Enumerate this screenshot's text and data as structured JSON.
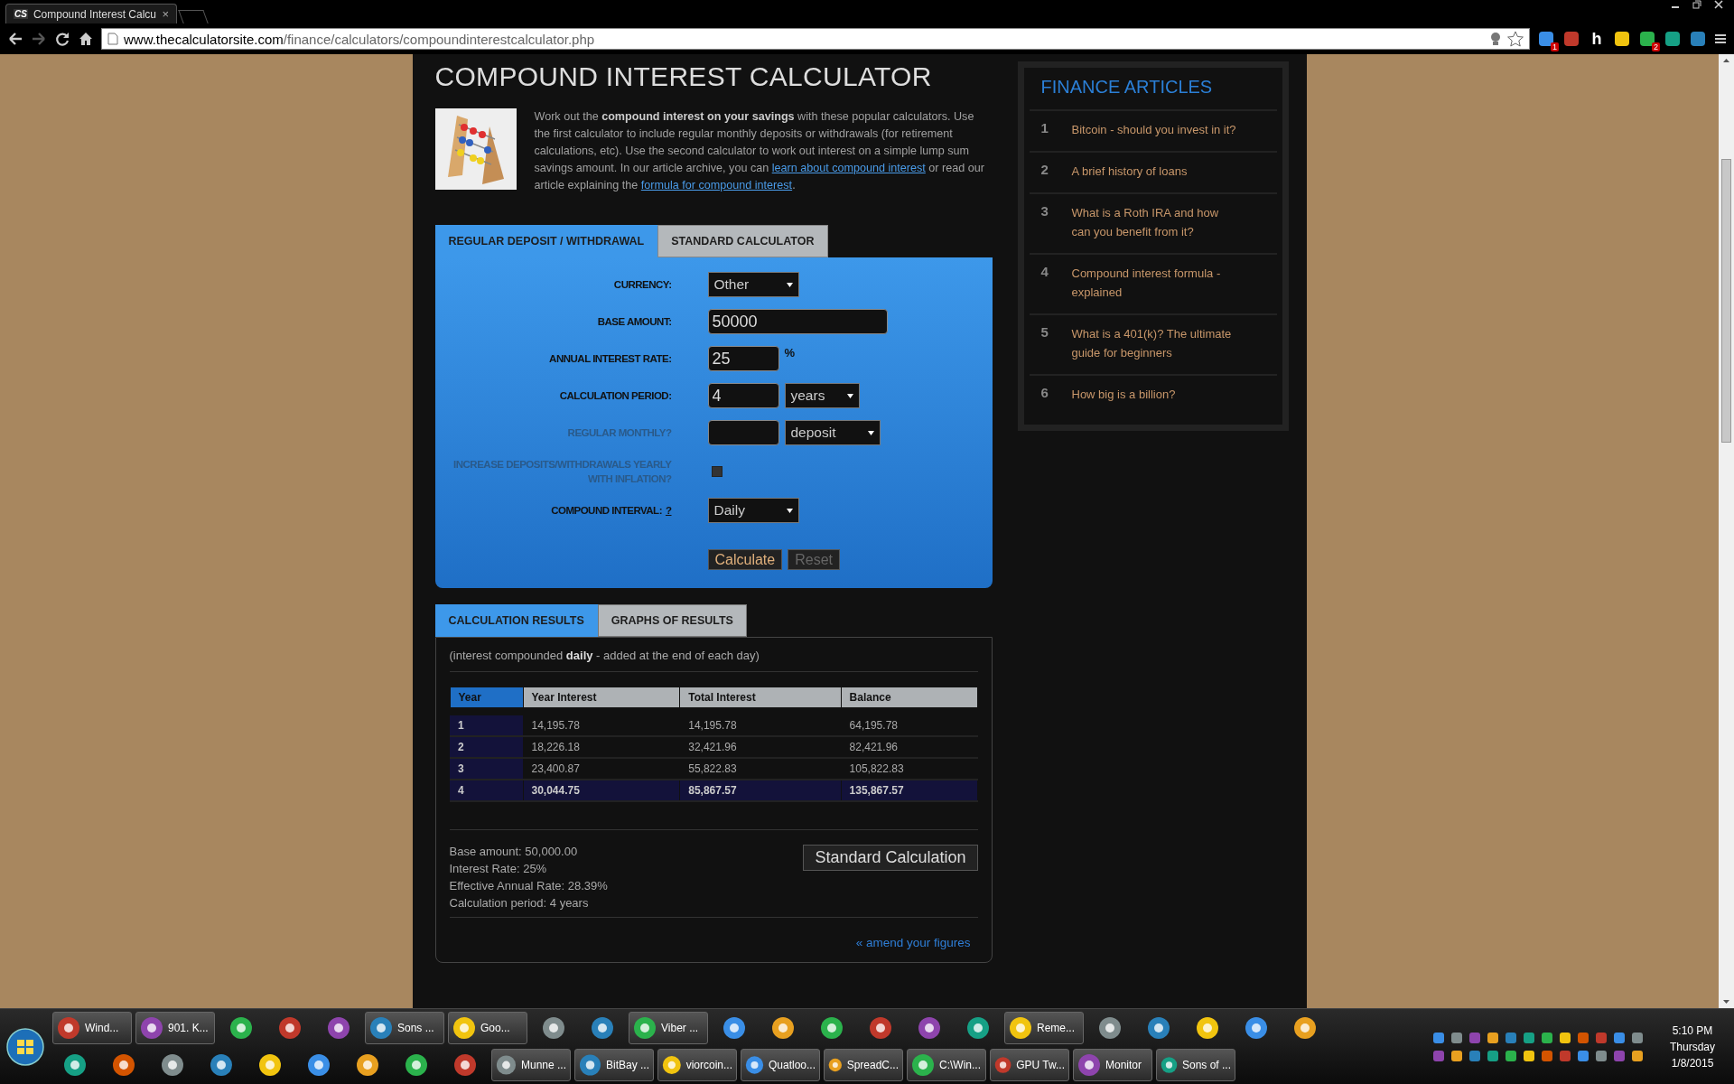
{
  "browser": {
    "tab": {
      "favicon": "CS",
      "title": "Compound Interest Calcu",
      "close": "×"
    },
    "url_host": "www.thecalculatorsite.com",
    "url_path": "/finance/calculators/compoundinterestcalculator.php",
    "extensions": [
      {
        "kind": "icon",
        "badge": "1"
      },
      {
        "kind": "icon"
      },
      {
        "kind": "letter",
        "glyph": "h"
      },
      {
        "kind": "icon"
      },
      {
        "kind": "icon",
        "badge": "2"
      },
      {
        "kind": "icon"
      },
      {
        "kind": "icon"
      }
    ]
  },
  "page": {
    "title": "COMPOUND INTEREST CALCULATOR",
    "intro": [
      {
        "kind": "text",
        "text": "Work out the **compound interest on your savings** with these popular calculators. Use the first calculator to include regular monthly deposits or withdrawals (for retirement calculations, etc). Use the second calculator to work out interest on a simple lump sum savings amount. In our article archive, you can "
      },
      {
        "kind": "link",
        "text": "learn about compound interest"
      },
      {
        "kind": "text",
        "text": " or read our article explaining the "
      },
      {
        "kind": "link",
        "text": "formula for compound interest"
      },
      {
        "kind": "text",
        "text": "."
      }
    ],
    "calc_tabs": [
      {
        "label": "REGULAR DEPOSIT / WITHDRAWAL",
        "selected": true
      },
      {
        "label": "STANDARD CALCULATOR",
        "selected": false
      }
    ],
    "fields": [
      {
        "label": "CURRENCY:",
        "disabled": false,
        "controls": [
          {
            "kind": "select",
            "value": "Other"
          }
        ]
      },
      {
        "label": "BASE AMOUNT:",
        "disabled": false,
        "controls": [
          {
            "kind": "wide-input",
            "value": "50000"
          }
        ]
      },
      {
        "label": "ANNUAL INTEREST RATE:",
        "disabled": false,
        "controls": [
          {
            "kind": "input",
            "value": "25"
          },
          {
            "kind": "unit",
            "text": "%"
          }
        ]
      },
      {
        "label": "CALCULATION PERIOD:",
        "disabled": false,
        "controls": [
          {
            "kind": "input",
            "value": "4"
          },
          {
            "kind": "small-select",
            "value": "years"
          }
        ]
      },
      {
        "label": "REGULAR MONTHLY?",
        "disabled": true,
        "controls": [
          {
            "kind": "input"
          },
          {
            "kind": "select",
            "value": "deposit"
          }
        ]
      },
      {
        "label": "INCREASE DEPOSITS/WITHDRAWALS YEARLY WITH INFLATION?",
        "disabled": true,
        "controls": [
          {
            "kind": "checkbox",
            "checked": false
          }
        ]
      },
      {
        "label": "COMPOUND INTERVAL:",
        "help": "?",
        "disabled": false,
        "controls": [
          {
            "kind": "select",
            "value": "Daily"
          }
        ]
      }
    ],
    "buttons": [
      {
        "label": "Calculate",
        "disabled": false
      },
      {
        "label": "Reset",
        "disabled": true
      }
    ],
    "result_tabs": [
      {
        "label": "CALCULATION RESULTS",
        "selected": true
      },
      {
        "label": "GRAPHS OF RESULTS",
        "selected": false
      }
    ],
    "note": "(interest compounded **daily** - added at the end of each day)",
    "table": {
      "columns": [
        "Year",
        "Year Interest",
        "Total Interest",
        "Balance"
      ],
      "rows": [
        {
          "cells": [
            "1",
            "14,195.78",
            "14,195.78",
            "64,195.78"
          ],
          "selected": false
        },
        {
          "cells": [
            "2",
            "18,226.18",
            "32,421.96",
            "82,421.96"
          ],
          "selected": false
        },
        {
          "cells": [
            "3",
            "23,400.87",
            "55,822.83",
            "105,822.83"
          ],
          "selected": false
        },
        {
          "cells": [
            "4",
            "30,044.75",
            "85,867.57",
            "135,867.57"
          ],
          "selected": true
        }
      ]
    },
    "summary": [
      "Base amount: 50,000.00",
      "Interest Rate: 25%",
      "Effective Annual Rate: 28.39%",
      "Calculation period: 4 years"
    ],
    "standard_button": "Standard Calculation",
    "amend_link": "« amend your figures"
  },
  "sidebar": {
    "title": "FINANCE ARTICLES",
    "articles": [
      {
        "number": "1",
        "title": "Bitcoin - should you invest in it?"
      },
      {
        "number": "2",
        "title": "A brief history of loans"
      },
      {
        "number": "3",
        "title": "What is a Roth IRA and how can you benefit from it?"
      },
      {
        "number": "4",
        "title": "Compound interest formula - explained"
      },
      {
        "number": "5",
        "title": "What is a 401(k)? The ultimate guide for beginners"
      },
      {
        "number": "6",
        "title": "How big is a billion?"
      }
    ]
  },
  "taskbar": {
    "row_1": [
      {
        "kind": "button",
        "label": "Wind..."
      },
      {
        "kind": "button",
        "label": "901. K..."
      },
      {
        "kind": "icon"
      },
      {
        "kind": "icon"
      },
      {
        "kind": "icon"
      },
      {
        "kind": "button",
        "label": "Sons ..."
      },
      {
        "kind": "button",
        "label": "Goo..."
      },
      {
        "kind": "icon"
      },
      {
        "kind": "icon"
      },
      {
        "kind": "button",
        "label": "Viber ..."
      },
      {
        "kind": "icon"
      },
      {
        "kind": "icon"
      },
      {
        "kind": "icon"
      },
      {
        "kind": "icon"
      },
      {
        "kind": "icon"
      },
      {
        "kind": "icon"
      },
      {
        "kind": "button",
        "label": "Reme..."
      },
      {
        "kind": "icon"
      },
      {
        "kind": "icon"
      },
      {
        "kind": "icon"
      },
      {
        "kind": "icon"
      },
      {
        "kind": "icon"
      }
    ],
    "row_2": [
      {
        "kind": "icon"
      },
      {
        "kind": "icon"
      },
      {
        "kind": "icon"
      },
      {
        "kind": "icon"
      },
      {
        "kind": "icon"
      },
      {
        "kind": "icon"
      },
      {
        "kind": "icon"
      },
      {
        "kind": "icon"
      },
      {
        "kind": "icon"
      },
      {
        "kind": "button",
        "label": "Munne ..."
      },
      {
        "kind": "button",
        "label": "BitBay ..."
      },
      {
        "kind": "button",
        "label": "viorcoin..."
      },
      {
        "kind": "button",
        "label": "Quatloo..."
      },
      {
        "kind": "button",
        "label": "SpreadC..."
      },
      {
        "kind": "button",
        "label": "C:\\Win..."
      },
      {
        "kind": "button",
        "label": "GPU Tw..."
      },
      {
        "kind": "button",
        "label": "Monitor"
      },
      {
        "kind": "button",
        "label": "Sons of ..."
      }
    ],
    "clock": {
      "time": "5:10 PM",
      "day": "Thursday",
      "date": "1/8/2015"
    }
  }
}
